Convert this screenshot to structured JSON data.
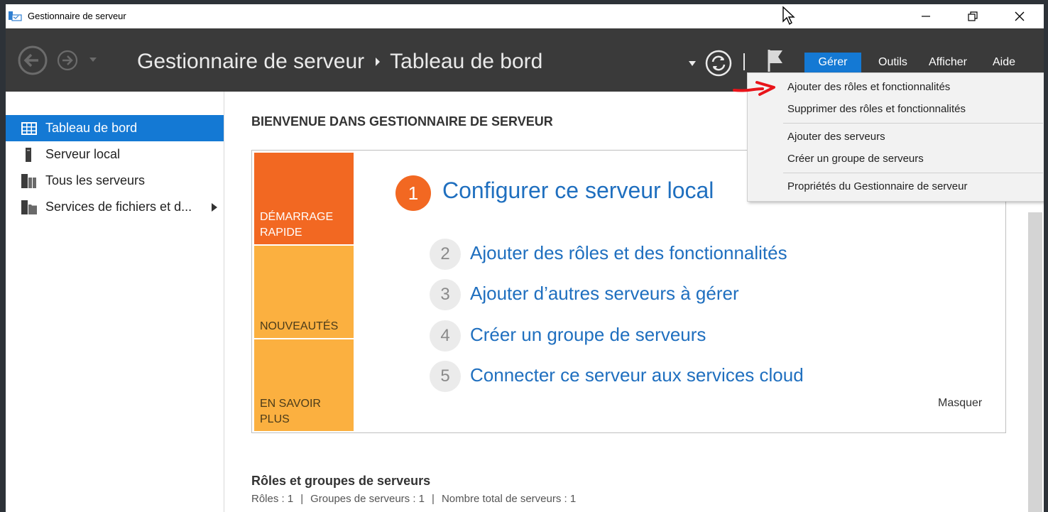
{
  "window": {
    "title": "Gestionnaire de serveur"
  },
  "header": {
    "breadcrumb_root": "Gestionnaire de serveur",
    "breadcrumb_current": "Tableau de bord",
    "menus": [
      {
        "label": "Gérer",
        "active": true
      },
      {
        "label": "Outils"
      },
      {
        "label": "Afficher"
      },
      {
        "label": "Aide"
      }
    ]
  },
  "dropdown": {
    "items": [
      "Ajouter des rôles et fonctionnalités",
      "Supprimer des rôles et fonctionnalités",
      "Ajouter des serveurs",
      "Créer un groupe de serveurs",
      "Propriétés du Gestionnaire de serveur"
    ]
  },
  "sidebar": {
    "items": [
      {
        "label": "Tableau de bord",
        "icon": "dashboard-icon",
        "active": true
      },
      {
        "label": "Serveur local",
        "icon": "server-icon"
      },
      {
        "label": "Tous les serveurs",
        "icon": "servers-icon"
      },
      {
        "label": "Services de fichiers et d...",
        "icon": "file-services-icon",
        "expandable": true
      }
    ]
  },
  "main": {
    "welcome_title": "BIENVENUE DANS GESTIONNAIRE DE SERVEUR",
    "tiles": {
      "demarrage": "DÉMARRAGE RAPIDE",
      "nouveautes": "NOUVEAUTÉS",
      "savoir": "EN SAVOIR PLUS"
    },
    "steps": [
      {
        "num": "1",
        "label": "Configurer ce serveur local"
      },
      {
        "num": "2",
        "label": "Ajouter des rôles et des fonctionnalités"
      },
      {
        "num": "3",
        "label": "Ajouter d’autres serveurs à gérer"
      },
      {
        "num": "4",
        "label": "Créer un groupe de serveurs"
      },
      {
        "num": "5",
        "label": "Connecter ce serveur aux services cloud"
      }
    ],
    "hide_label": "Masquer",
    "roles_title": "Rôles et groupes de serveurs",
    "roles_summary": {
      "roles": "Rôles : 1",
      "groups": "Groupes de serveurs : 1",
      "total": "Nombre total de serveurs : 1"
    }
  },
  "colors": {
    "accent": "#1479d4",
    "orange": "#f26822",
    "amber": "#fbb040",
    "header_bg": "#3a3a3a",
    "link": "#1f6fbf"
  }
}
